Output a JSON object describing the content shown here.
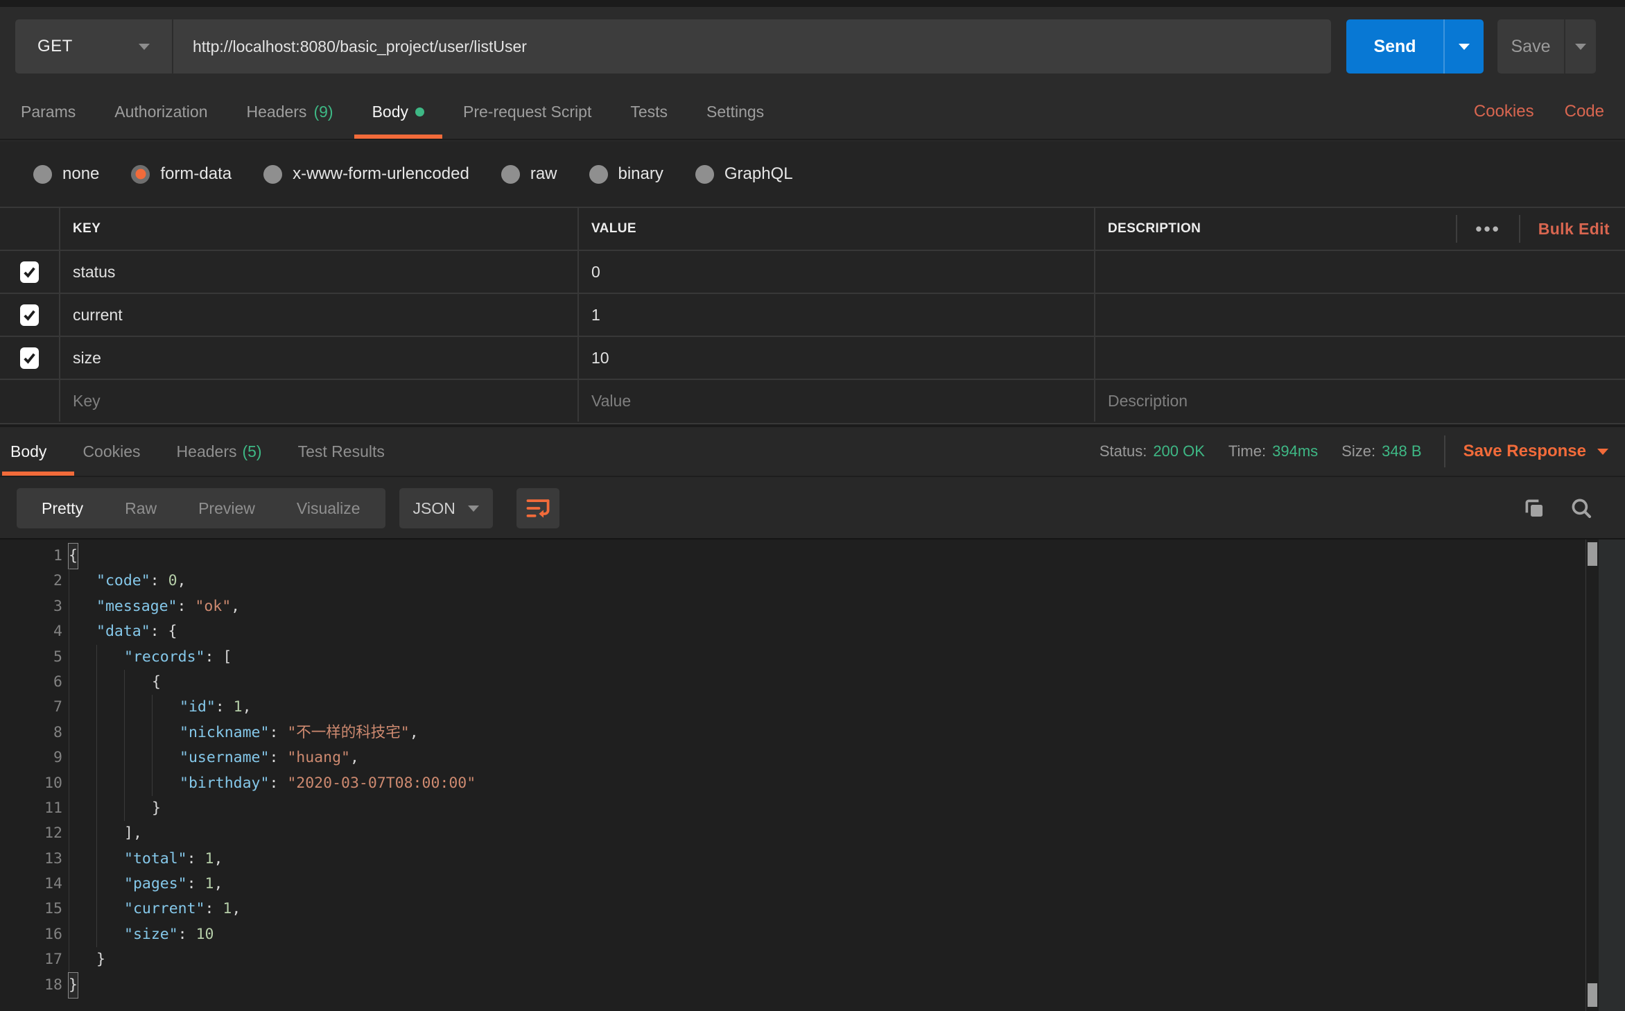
{
  "request": {
    "method": "GET",
    "url": "http://localhost:8080/basic_project/user/listUser",
    "send_label": "Send",
    "save_label": "Save",
    "tabs": [
      {
        "label": "Params"
      },
      {
        "label": "Authorization"
      },
      {
        "label": "Headers",
        "count": "(9)"
      },
      {
        "label": "Body",
        "active": true,
        "dot": true
      },
      {
        "label": "Pre-request Script"
      },
      {
        "label": "Tests"
      },
      {
        "label": "Settings"
      }
    ],
    "links": [
      "Cookies",
      "Code"
    ],
    "body_modes": [
      {
        "label": "none"
      },
      {
        "label": "form-data",
        "selected": true
      },
      {
        "label": "x-www-form-urlencoded"
      },
      {
        "label": "raw"
      },
      {
        "label": "binary"
      },
      {
        "label": "GraphQL"
      }
    ],
    "form_table": {
      "headers": {
        "key": "KEY",
        "value": "VALUE",
        "description": "DESCRIPTION"
      },
      "bulk_edit_label": "Bulk Edit",
      "more_options_glyph": "•••",
      "rows": [
        {
          "key": "status",
          "value": "0",
          "description": "",
          "checked": true
        },
        {
          "key": "current",
          "value": "1",
          "description": "",
          "checked": true
        },
        {
          "key": "size",
          "value": "10",
          "description": "",
          "checked": true
        }
      ],
      "placeholders": {
        "key": "Key",
        "value": "Value",
        "description": "Description"
      }
    }
  },
  "response": {
    "tabs": [
      {
        "label": "Body",
        "active": true
      },
      {
        "label": "Cookies"
      },
      {
        "label": "Headers",
        "count": "(5)"
      },
      {
        "label": "Test Results"
      }
    ],
    "meta": [
      {
        "label": "Status:",
        "value": "200 OK"
      },
      {
        "label": "Time:",
        "value": "394ms"
      },
      {
        "label": "Size:",
        "value": "348 B"
      }
    ],
    "save_response_label": "Save Response",
    "view_tabs": [
      {
        "label": "Pretty",
        "active": true
      },
      {
        "label": "Raw"
      },
      {
        "label": "Preview"
      },
      {
        "label": "Visualize"
      }
    ],
    "format": "JSON",
    "code_lines": [
      {
        "n": 1,
        "indent": 0,
        "tokens": [
          {
            "t": "bracket",
            "v": "{"
          }
        ]
      },
      {
        "n": 2,
        "indent": 1,
        "tokens": [
          {
            "t": "key",
            "v": "\"code\""
          },
          {
            "t": "punct",
            "v": ": "
          },
          {
            "t": "num",
            "v": "0"
          },
          {
            "t": "punct",
            "v": ","
          }
        ]
      },
      {
        "n": 3,
        "indent": 1,
        "tokens": [
          {
            "t": "key",
            "v": "\"message\""
          },
          {
            "t": "punct",
            "v": ": "
          },
          {
            "t": "str",
            "v": "\"ok\""
          },
          {
            "t": "punct",
            "v": ","
          }
        ]
      },
      {
        "n": 4,
        "indent": 1,
        "tokens": [
          {
            "t": "key",
            "v": "\"data\""
          },
          {
            "t": "punct",
            "v": ": {"
          }
        ]
      },
      {
        "n": 5,
        "indent": 2,
        "tokens": [
          {
            "t": "key",
            "v": "\"records\""
          },
          {
            "t": "punct",
            "v": ": ["
          }
        ]
      },
      {
        "n": 6,
        "indent": 3,
        "tokens": [
          {
            "t": "punct",
            "v": "{"
          }
        ]
      },
      {
        "n": 7,
        "indent": 4,
        "tokens": [
          {
            "t": "key",
            "v": "\"id\""
          },
          {
            "t": "punct",
            "v": ": "
          },
          {
            "t": "num",
            "v": "1"
          },
          {
            "t": "punct",
            "v": ","
          }
        ]
      },
      {
        "n": 8,
        "indent": 4,
        "tokens": [
          {
            "t": "key",
            "v": "\"nickname\""
          },
          {
            "t": "punct",
            "v": ": "
          },
          {
            "t": "str",
            "v": "\"不一样的科技宅\""
          },
          {
            "t": "punct",
            "v": ","
          }
        ]
      },
      {
        "n": 9,
        "indent": 4,
        "tokens": [
          {
            "t": "key",
            "v": "\"username\""
          },
          {
            "t": "punct",
            "v": ": "
          },
          {
            "t": "str",
            "v": "\"huang\""
          },
          {
            "t": "punct",
            "v": ","
          }
        ]
      },
      {
        "n": 10,
        "indent": 4,
        "tokens": [
          {
            "t": "key",
            "v": "\"birthday\""
          },
          {
            "t": "punct",
            "v": ": "
          },
          {
            "t": "str",
            "v": "\"2020-03-07T08:00:00\""
          }
        ]
      },
      {
        "n": 11,
        "indent": 3,
        "tokens": [
          {
            "t": "punct",
            "v": "}"
          }
        ]
      },
      {
        "n": 12,
        "indent": 2,
        "tokens": [
          {
            "t": "punct",
            "v": "],"
          }
        ]
      },
      {
        "n": 13,
        "indent": 2,
        "tokens": [
          {
            "t": "key",
            "v": "\"total\""
          },
          {
            "t": "punct",
            "v": ": "
          },
          {
            "t": "num",
            "v": "1"
          },
          {
            "t": "punct",
            "v": ","
          }
        ]
      },
      {
        "n": 14,
        "indent": 2,
        "tokens": [
          {
            "t": "key",
            "v": "\"pages\""
          },
          {
            "t": "punct",
            "v": ": "
          },
          {
            "t": "num",
            "v": "1"
          },
          {
            "t": "punct",
            "v": ","
          }
        ]
      },
      {
        "n": 15,
        "indent": 2,
        "tokens": [
          {
            "t": "key",
            "v": "\"current\""
          },
          {
            "t": "punct",
            "v": ": "
          },
          {
            "t": "num",
            "v": "1"
          },
          {
            "t": "punct",
            "v": ","
          }
        ]
      },
      {
        "n": 16,
        "indent": 2,
        "tokens": [
          {
            "t": "key",
            "v": "\"size\""
          },
          {
            "t": "punct",
            "v": ": "
          },
          {
            "t": "num",
            "v": "10"
          }
        ]
      },
      {
        "n": 17,
        "indent": 1,
        "tokens": [
          {
            "t": "punct",
            "v": "}"
          }
        ]
      },
      {
        "n": 18,
        "indent": 0,
        "tokens": [
          {
            "t": "bracket",
            "v": "}"
          }
        ]
      }
    ]
  },
  "colors": {
    "accent_orange": "#f26b3a",
    "success_green": "#3eb885",
    "send_blue": "#0878d4"
  }
}
